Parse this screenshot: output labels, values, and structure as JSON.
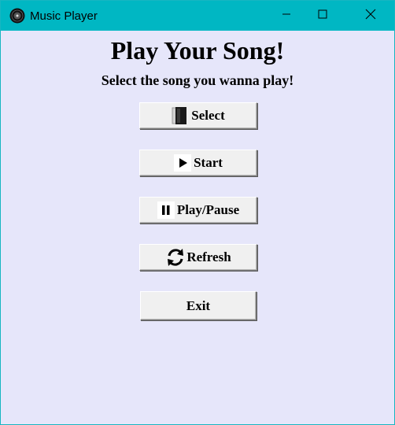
{
  "window": {
    "title": "Music Player",
    "accent_color": "#00b7c3",
    "background_color": "#e6e6fa",
    "app_icon": "vinyl-record-icon",
    "controls": [
      "minimize-icon",
      "maximize-icon",
      "close-icon"
    ]
  },
  "main": {
    "heading": "Play Your Song!",
    "subheading": "Select the song you wanna play!"
  },
  "buttons": [
    {
      "label": "Select",
      "icon": "file-icon"
    },
    {
      "label": "Start",
      "icon": "play-icon"
    },
    {
      "label": "Play/Pause",
      "icon": "pause-icon"
    },
    {
      "label": "Refresh",
      "icon": "refresh-icon"
    },
    {
      "label": "Exit",
      "icon": ""
    }
  ]
}
